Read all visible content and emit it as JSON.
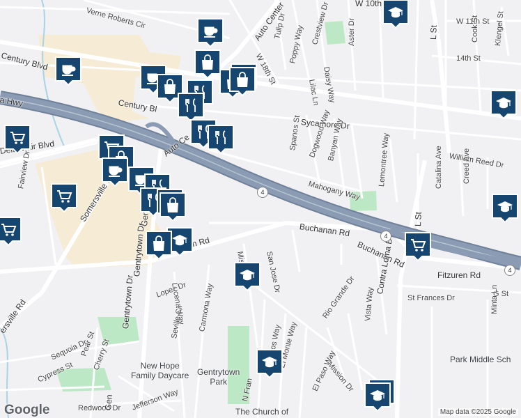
{
  "attribution": "Map data ©2025 Google",
  "logo": "Google",
  "colors": {
    "background": "#f1f0f3",
    "highway": "#8a9bb3",
    "highway_casing": "#6f8199",
    "street": "#ffffff",
    "commercial": "#f6ecd6",
    "park": "#bde8c5",
    "water": "#a7d4e6",
    "marker": "#16466f",
    "marker_border": "#ffffff"
  },
  "streets": {
    "verne_roberts_cir": "Verne Roberts Cir",
    "century_blvd_1": "Century Blvd",
    "century_blvd_2": "Century Bl",
    "auto_center_1": "Auto Center",
    "auto_center_2": "Auto Ce",
    "w_18th_st": "W 18th St",
    "tulip_dr": "Tulip Dr",
    "poppy_way": "Poppy Way",
    "crestview_dr": "Crestview Dr",
    "aster_dr": "Aster Dr",
    "daisy_way": "Daisy Way",
    "lilac_ln": "Lilac Ln",
    "w_10th": "W 10th",
    "w_11th_st": "W 11th St",
    "cook_st": "Cook St",
    "klengel_st": "Klengel St",
    "l_st_1": "L St",
    "l_st_2": "L St",
    "fourteenth_st": "14th St",
    "sycamore_dr": "Sycamore Dr",
    "spanos_st": "Spanos St",
    "dogwood_way": "Dogwood Way",
    "banyan_way": "Banyan Way",
    "william_reed_dr": "William Reed Dr",
    "lemontree_way": "Lemontree Way",
    "catalina_ave": "Catalina Ave",
    "creed_ave": "Creed Ave",
    "mahogany_way": "Mahogany Way",
    "delta_fair_blvd": "Delta Fair Blvd",
    "fairview_dr": "Fairview Dr",
    "somersville_rd_1": "Somersville Rd",
    "somersville_rd_2": "ersville Rd",
    "hwy": "a Hwy",
    "buchanan_rd_1": "Buchanan Rd",
    "buchanan_rd_2": "Buchanan Rd",
    "buchanan_rd_3": "Buchanan Rd",
    "san_jose_dr": "San Jose Dr",
    "mis": "Mis",
    "contra_loma_blvd": "Contra Loma B",
    "fitzuren_rd": "Fitzuren Rd",
    "g_st": "G St",
    "minta_ln": "Minta Ln",
    "vista_way": "Vista Way",
    "st_frances_dr": "St Frances Dr",
    "rio_grande_dr": "Rio Grande Dr",
    "mission_dr": "Mission Dr",
    "el_paso_way": "El Paso Way",
    "el_monte_way": "El Monte Way",
    "los_altos_way": "Los Altos Way",
    "n_fran": "N Fran",
    "lopez_dr": "Lopez Dr",
    "lucena_way": "Lucena Way",
    "carmona_way": "Carmona Way",
    "seville_cir": "Seville Cir",
    "gentrytown_dr_1": "Gentrytown Dr",
    "gentrytown_dr_2": "Gent",
    "gentrytown_dr_3": "Gentrytown Dr",
    "sequoia_dr": "Sequoia Dr",
    "pear_st": "Pear St",
    "cherry_st": "Cherry St",
    "cypress_st": "Cypress St",
    "redwood_dr": "Redwood Dr",
    "jefferson_way": "Jefferson Way",
    "gen": "Gen"
  },
  "places": {
    "gentrytown_park": "Gentrytown\nPark",
    "new_hope_daycare": "New Hope\nFamily Daycare",
    "park_middle_school": "Park Middle Sch",
    "church": "The Church of"
  },
  "route_shields": [
    "4",
    "4",
    "4"
  ],
  "markers": [
    {
      "type": "cafe",
      "icon": "coffee-cup-icon"
    },
    {
      "type": "cafe",
      "icon": "coffee-cup-icon"
    },
    {
      "type": "shop",
      "icon": "shopping-bag-icon"
    },
    {
      "type": "shop",
      "icon": "shopping-bag-icon"
    },
    {
      "type": "cafe",
      "icon": "coffee-cup-icon"
    },
    {
      "type": "shop",
      "icon": "shopping-bag-icon"
    },
    {
      "type": "restaurant",
      "icon": "fork-knife-icon"
    },
    {
      "type": "shop",
      "icon": "shopping-bag-icon"
    },
    {
      "type": "shop",
      "icon": "shopping-bag-icon"
    },
    {
      "type": "restaurant",
      "icon": "fork-knife-icon"
    },
    {
      "type": "restaurant",
      "icon": "fork-knife-icon"
    },
    {
      "type": "restaurant",
      "icon": "fork-knife-icon"
    },
    {
      "type": "grocery",
      "icon": "shopping-cart-icon"
    },
    {
      "type": "grocery",
      "icon": "shopping-cart-icon"
    },
    {
      "type": "shop",
      "icon": "shopping-bag-icon"
    },
    {
      "type": "cafe",
      "icon": "coffee-cup-icon"
    },
    {
      "type": "cafe",
      "icon": "coffee-cup-icon"
    },
    {
      "type": "restaurant",
      "icon": "fork-knife-icon"
    },
    {
      "type": "restaurant",
      "icon": "fork-knife-icon"
    },
    {
      "type": "shop",
      "icon": "shopping-bag-icon"
    },
    {
      "type": "shop",
      "icon": "shopping-bag-icon"
    },
    {
      "type": "grocery",
      "icon": "shopping-cart-icon"
    },
    {
      "type": "grocery",
      "icon": "shopping-cart-icon"
    },
    {
      "type": "school",
      "icon": "graduation-cap-icon"
    },
    {
      "type": "shop",
      "icon": "shopping-bag-icon"
    },
    {
      "type": "school",
      "icon": "graduation-cap-icon"
    },
    {
      "type": "school",
      "icon": "graduation-cap-icon"
    },
    {
      "type": "school",
      "icon": "graduation-cap-icon"
    },
    {
      "type": "school",
      "icon": "graduation-cap-icon"
    },
    {
      "type": "school",
      "icon": "graduation-cap-icon"
    },
    {
      "type": "grocery",
      "icon": "shopping-cart-icon"
    },
    {
      "type": "grocery",
      "icon": "shopping-cart-icon"
    },
    {
      "type": "school",
      "icon": "graduation-cap-icon"
    }
  ]
}
